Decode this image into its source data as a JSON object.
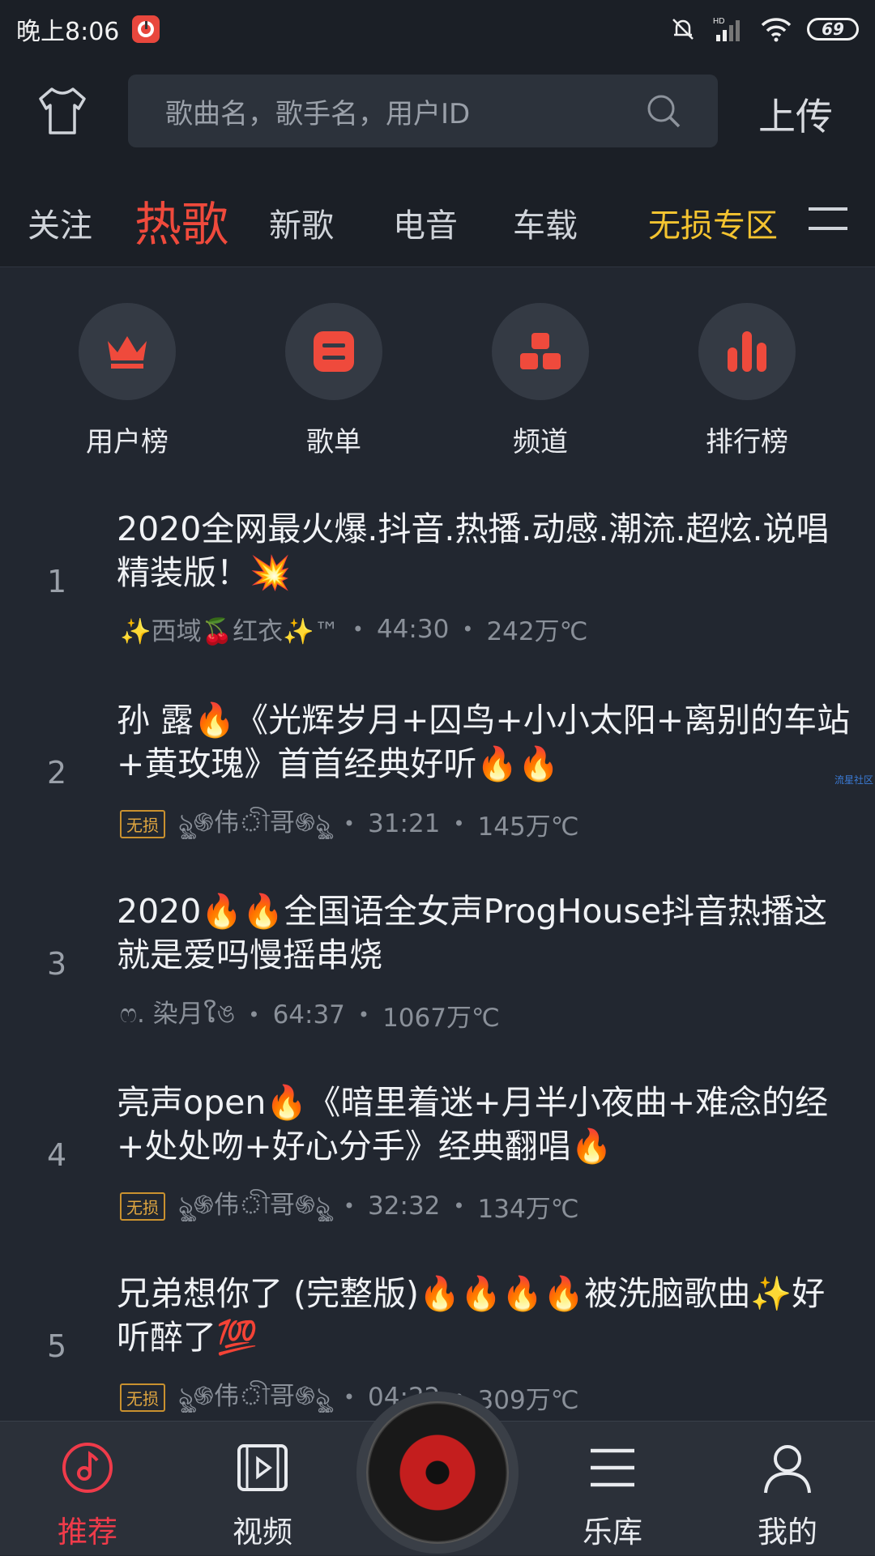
{
  "status_bar": {
    "time": "晚上8:06",
    "battery": "69",
    "hd": "HD"
  },
  "header": {
    "search_placeholder": "歌曲名，歌手名，用户ID",
    "upload_label": "上传"
  },
  "tabs": [
    {
      "label": "关注",
      "active": false
    },
    {
      "label": "热歌",
      "active": true
    },
    {
      "label": "新歌",
      "active": false
    },
    {
      "label": "电音",
      "active": false
    },
    {
      "label": "车载",
      "active": false
    },
    {
      "label": "无损专区",
      "active": false
    }
  ],
  "categories": [
    {
      "label": "用户榜",
      "icon": "crown-icon"
    },
    {
      "label": "歌单",
      "icon": "playlist-icon"
    },
    {
      "label": "频道",
      "icon": "channel-icon"
    },
    {
      "label": "排行榜",
      "icon": "chart-bars-icon"
    }
  ],
  "songs": [
    {
      "rank": "1",
      "title": "2020全网最火爆.抖音.热播.动感.潮流.超炫.说唱精装版！💥",
      "badge": "",
      "uploader": "✨西域🍒红衣✨™",
      "duration": "44:30",
      "heat": "242万℃"
    },
    {
      "rank": "2",
      "title": "孙 露🔥《光辉岁月+囚鸟+小小太阳+离别的车站+黄玫瑰》首首经典好听🔥🔥",
      "badge": "无损",
      "uploader": "ৡৣ֍伟ী哥֍ৡৣ",
      "duration": "31:21",
      "heat": "145万℃"
    },
    {
      "rank": "3",
      "title": "2020🔥🔥全国语全女声ProgHouse抖音热播这就是爱吗慢摇串烧",
      "badge": "",
      "uploader": "ෆ. 染月ໃঙ",
      "duration": "64:37",
      "heat": "1067万℃"
    },
    {
      "rank": "4",
      "title": "亮声open🔥《暗里着迷+月半小夜曲+难念的经+处处吻+好心分手》经典翻唱🔥",
      "badge": "无损",
      "uploader": "ৡৣ֍伟ী哥֍ৡৣ",
      "duration": "32:32",
      "heat": "134万℃"
    },
    {
      "rank": "5",
      "title": "兄弟想你了 (完整版)🔥🔥🔥🔥被洗脑歌曲✨好听醉了💯",
      "badge": "无损",
      "uploader": "ৡৣ֍伟ী哥֍ৡৣ",
      "duration": "04:22",
      "heat": "309万℃"
    }
  ],
  "side_link": "流星社区",
  "bottom_nav": [
    {
      "label": "推荐",
      "active": true
    },
    {
      "label": "视频",
      "active": false
    },
    {
      "label": "乐库",
      "active": false
    },
    {
      "label": "我的",
      "active": false
    }
  ],
  "colors": {
    "accent": "#ef4a3c",
    "gold": "#f4c430",
    "background": "#222730"
  }
}
